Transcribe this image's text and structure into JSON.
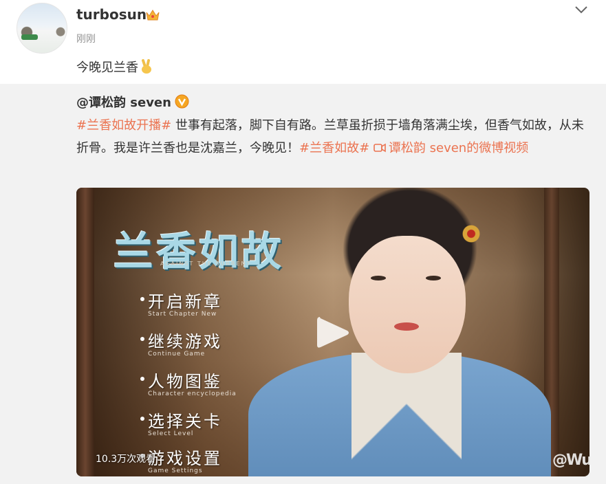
{
  "post": {
    "username": "turbosun",
    "timestamp": "刚刚",
    "text": "今晚见兰香",
    "icons": {
      "crown": "crown-badge-icon",
      "emoji": "victory-hand-emoji",
      "menu": "chevron-down-icon"
    }
  },
  "repost": {
    "author": "@谭松韵 seven",
    "author_badge": "verified-v-icon",
    "segments": [
      {
        "text": "#兰香如故开播#",
        "type": "link"
      },
      {
        "text": " 世事有起落，脚下自有路。兰草虽折损于墙角落满尘埃，但香气如故，从未折骨。我是许兰香也是沈嘉兰，今晚见！",
        "type": "text"
      },
      {
        "text": "#兰香如故#",
        "type": "link"
      },
      {
        "text": " ",
        "type": "text"
      },
      {
        "text": "谭松韵 seven的微博视频",
        "type": "video-link"
      }
    ],
    "video": {
      "game_title": "兰香如故",
      "game_subtitle": "AGAINST THE SURRENT",
      "menu": [
        {
          "zh": "开启新章",
          "en": "Start Chapter New"
        },
        {
          "zh": "继续游戏",
          "en": "Continue Game"
        },
        {
          "zh": "人物图鉴",
          "en": "Character encyclopedia"
        },
        {
          "zh": "选择关卡",
          "en": "Select Level"
        },
        {
          "zh": "游戏设置",
          "en": "Game Settings"
        }
      ],
      "view_count": "10.3万次观看",
      "watermark": "@Wu"
    }
  },
  "colors": {
    "link": "#eb7350",
    "repost_bg": "#f2f2f2",
    "muted": "#939393"
  }
}
